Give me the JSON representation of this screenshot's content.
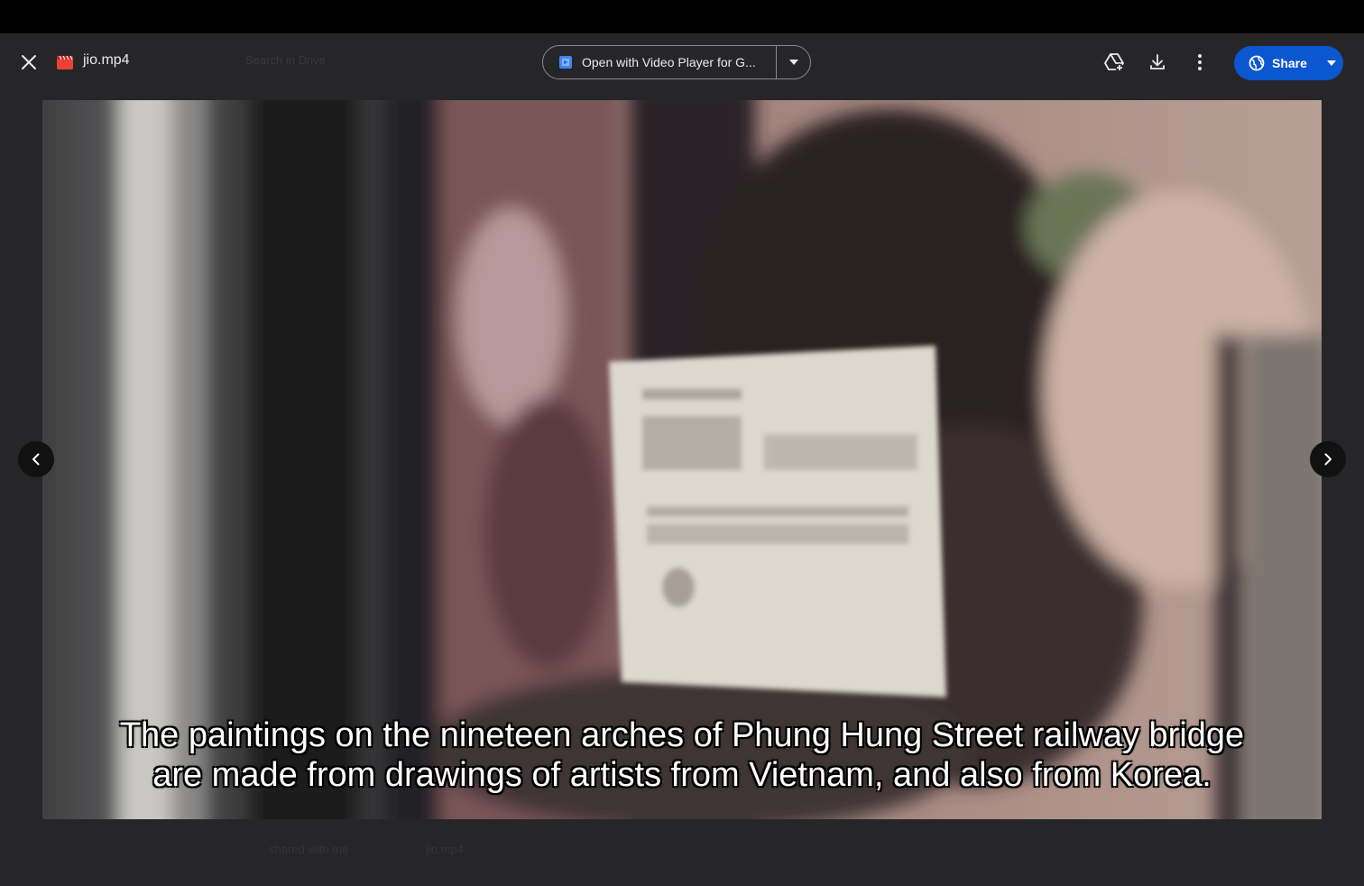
{
  "file": {
    "name": "jio.mp4",
    "icon": "video-file-icon"
  },
  "toolbar": {
    "search_ghost": "Search in Drive",
    "open_with_label": "Open with Video Player for G...",
    "share_label": "Share"
  },
  "video": {
    "caption_line1": "The paintings on the nineteen arches of Phung Hung Street railway bridge",
    "caption_line2": "are made from drawings of artists from Vietnam, and also from Korea."
  },
  "footer": {
    "owner_ghost": "shared with me",
    "location_ghost": "jio.mp4"
  },
  "colors": {
    "viewer_bg": "#262628",
    "share_accent": "#0b57d0",
    "file_icon_red": "#ea4335"
  }
}
